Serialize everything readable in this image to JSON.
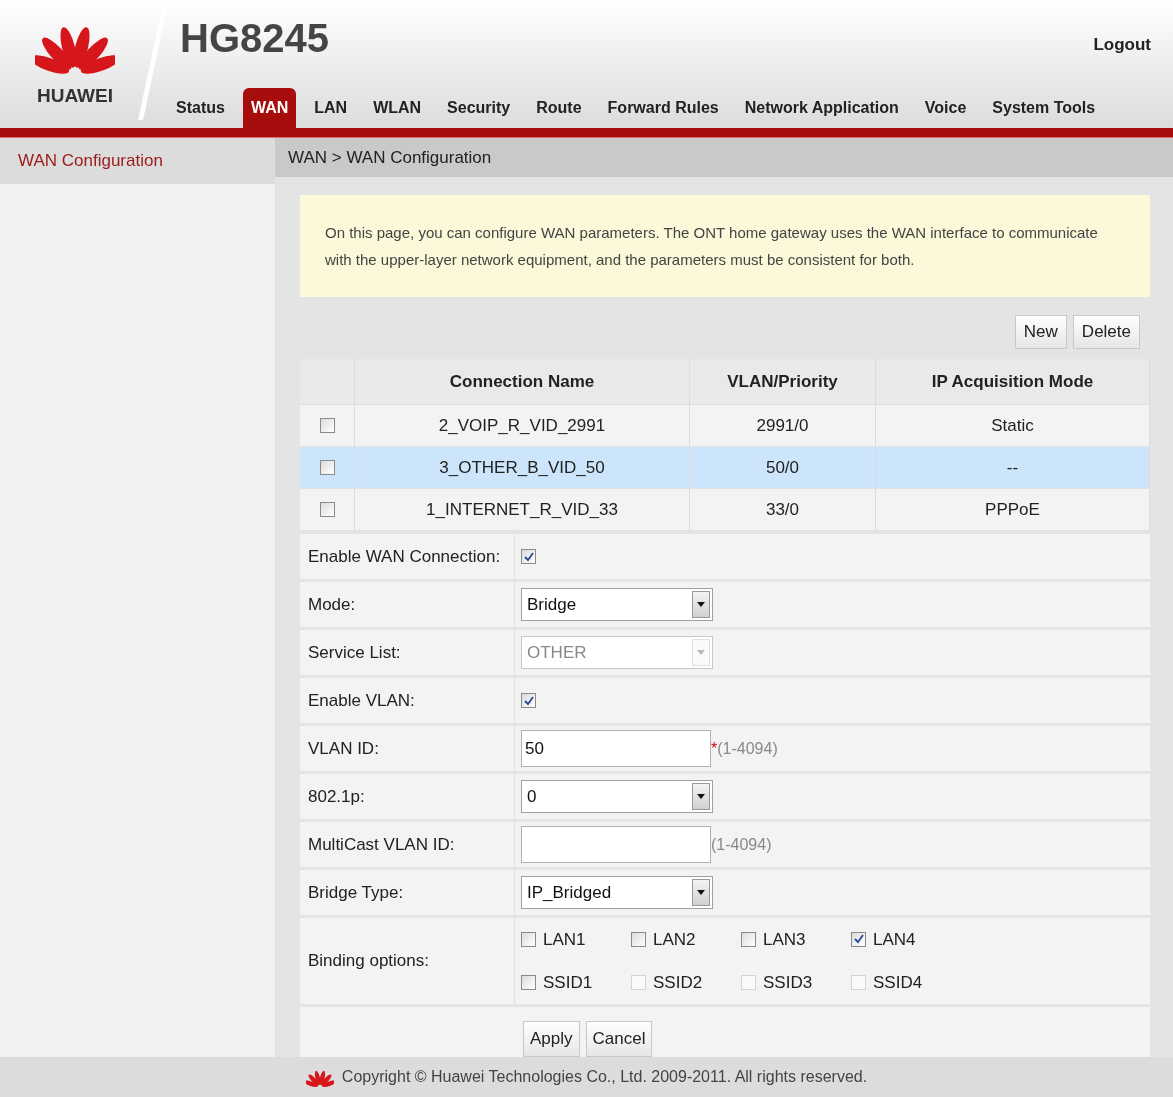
{
  "header": {
    "brand": "HUAWEI",
    "model": "HG8245",
    "logout": "Logout"
  },
  "nav": [
    {
      "label": "Status",
      "selected": false
    },
    {
      "label": "WAN",
      "selected": true
    },
    {
      "label": "LAN",
      "selected": false
    },
    {
      "label": "WLAN",
      "selected": false
    },
    {
      "label": "Security",
      "selected": false
    },
    {
      "label": "Route",
      "selected": false
    },
    {
      "label": "Forward Rules",
      "selected": false
    },
    {
      "label": "Network Application",
      "selected": false
    },
    {
      "label": "Voice",
      "selected": false
    },
    {
      "label": "System Tools",
      "selected": false
    }
  ],
  "sidebar": {
    "items": [
      {
        "label": "WAN Configuration",
        "selected": true
      }
    ]
  },
  "breadcrumb": "WAN > WAN Configuration",
  "notice": "On this page, you can configure WAN parameters. The ONT home gateway uses the WAN interface to communicate with the upper-layer network equipment, and the parameters must be consistent for both.",
  "table_buttons": [
    "New",
    "Delete"
  ],
  "table": {
    "columns": [
      "Connection Name",
      "VLAN/Priority",
      "IP Acquisition Mode"
    ],
    "rows": [
      {
        "checked": false,
        "selected": false,
        "cells": [
          "2_VOIP_R_VID_2991",
          "2991/0",
          "Static"
        ]
      },
      {
        "checked": false,
        "selected": true,
        "cells": [
          "3_OTHER_B_VID_50",
          "50/0",
          "--"
        ]
      },
      {
        "checked": false,
        "selected": false,
        "cells": [
          "1_INTERNET_R_VID_33",
          "33/0",
          "PPPoE"
        ]
      }
    ]
  },
  "form": [
    {
      "kind": "checkbox",
      "label": "Enable WAN Connection:",
      "checked": true
    },
    {
      "kind": "select",
      "label": "Mode:",
      "value": "Bridge",
      "disabled": false
    },
    {
      "kind": "select",
      "label": "Service List:",
      "value": "OTHER",
      "disabled": true
    },
    {
      "kind": "checkbox",
      "label": "Enable VLAN:",
      "checked": true
    },
    {
      "kind": "input",
      "label": "VLAN ID:",
      "value": "50",
      "mark": "*",
      "hint": "(1-4094)"
    },
    {
      "kind": "select",
      "label": "802.1p:",
      "value": "0",
      "disabled": false
    },
    {
      "kind": "input",
      "label": "MultiCast VLAN ID:",
      "hint": "(1-4094)"
    },
    {
      "kind": "select",
      "label": "Bridge Type:",
      "value": "IP_Bridged",
      "disabled": false
    },
    {
      "kind": "binding",
      "label": "Binding options:",
      "options": [
        {
          "label": "LAN1",
          "checked": false,
          "disabled": false
        },
        {
          "label": "LAN2",
          "checked": false,
          "disabled": false
        },
        {
          "label": "LAN3",
          "checked": false,
          "disabled": false
        },
        {
          "label": "LAN4",
          "checked": true,
          "disabled": false
        },
        {
          "label": "SSID1",
          "checked": false,
          "disabled": false
        },
        {
          "label": "SSID2",
          "checked": false,
          "disabled": true
        },
        {
          "label": "SSID3",
          "checked": false,
          "disabled": true
        },
        {
          "label": "SSID4",
          "checked": false,
          "disabled": true
        }
      ]
    }
  ],
  "form_buttons": [
    "Apply",
    "Cancel"
  ],
  "footer": "Copyright © Huawei Technologies Co., Ltd. 2009-2011. All rights reserved."
}
